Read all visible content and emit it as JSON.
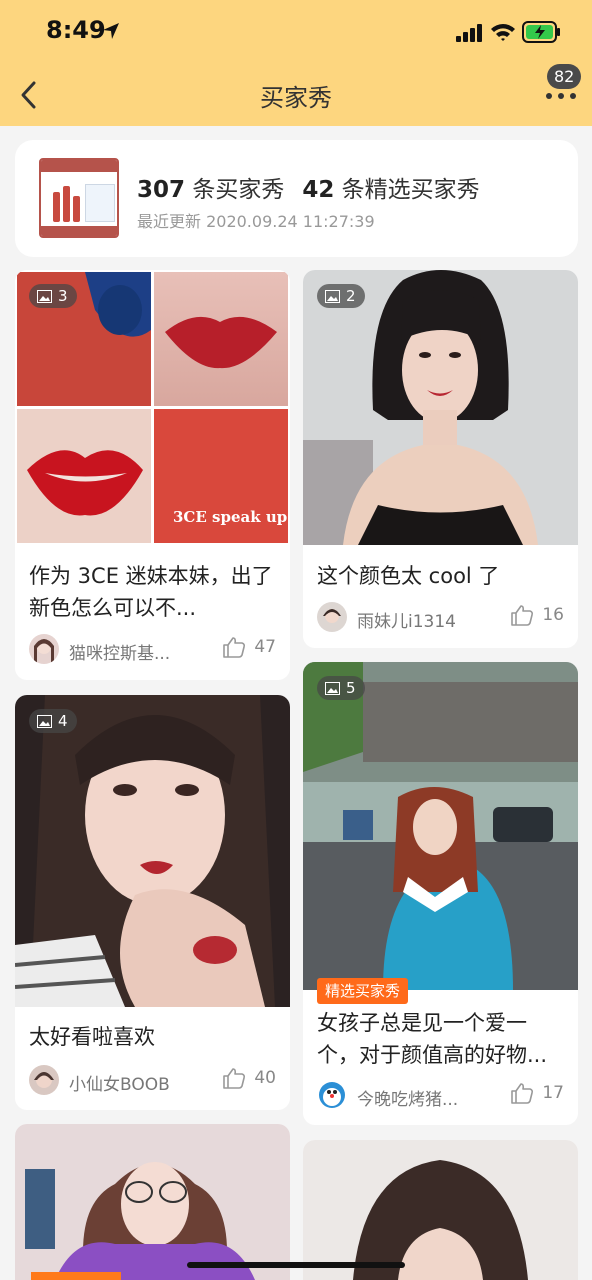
{
  "status_bar": {
    "time": "8:49"
  },
  "nav": {
    "title": "买家秀",
    "badge_count": "82"
  },
  "summary": {
    "buyer_show_count": "307",
    "buyer_show_label": "条买家秀",
    "featured_count": "42",
    "featured_label": "条精选买家秀",
    "updated_text": "最近更新 2020.09.24 11:27:39"
  },
  "colors": {
    "header_bg": "#fdd67f",
    "featured_tag": "#ff6a1a",
    "page_bg": "#f4f4f4"
  },
  "posts": [
    {
      "image_count": "3",
      "caption": "作为 3CE 迷妹本妹，出了新色怎么可以不...",
      "author": "猫咪控斯基...",
      "likes": "47",
      "photo_text": "3CE speak up",
      "featured": ""
    },
    {
      "image_count": "2",
      "caption": "这个颜色太 cool 了",
      "author": "雨妹儿i1314",
      "likes": "16",
      "featured": ""
    },
    {
      "image_count": "4",
      "caption": "太好看啦喜欢",
      "author": "小仙女BOOB",
      "likes": "40",
      "featured": ""
    },
    {
      "image_count": "5",
      "caption": "女孩子总是见一个爱一个，对于颜值高的好物...",
      "author": "今晚吃烤猪...",
      "likes": "17",
      "featured": "精选买家秀"
    }
  ]
}
